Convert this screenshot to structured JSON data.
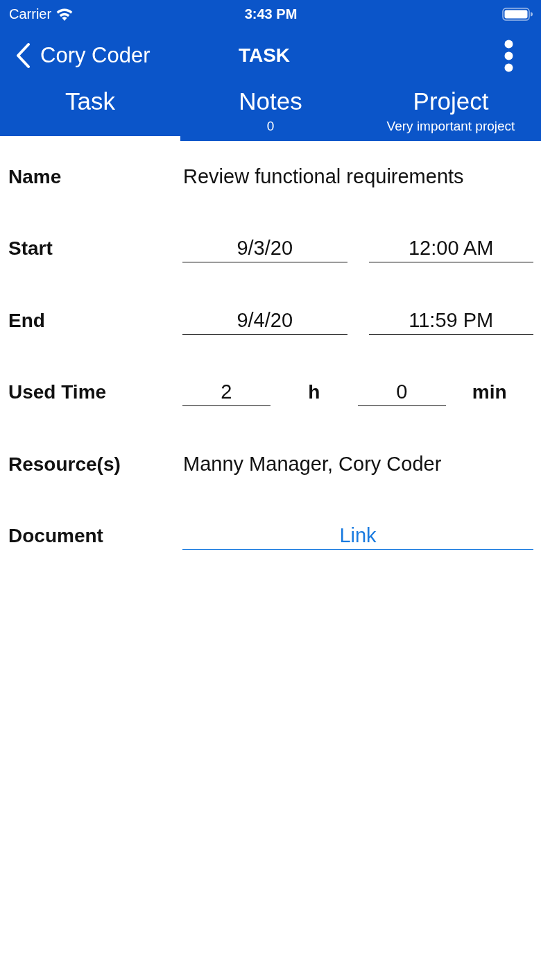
{
  "status_bar": {
    "carrier": "Carrier",
    "time": "3:43 PM"
  },
  "nav_bar": {
    "back_label": "Cory Coder",
    "title": "TASK"
  },
  "tabs": [
    {
      "label": "Task",
      "selected": true
    },
    {
      "label": "Notes",
      "subtitle": "0",
      "selected": false
    },
    {
      "label": "Project",
      "subtitle": "Very important project",
      "selected": false
    }
  ],
  "form": {
    "rows": [
      {
        "kind": "text",
        "label": "Name",
        "value": "Review functional requirements"
      },
      {
        "kind": "datetime",
        "label": "Start",
        "date": "9/3/20",
        "time": "12:00 AM"
      },
      {
        "kind": "datetime",
        "label": "End",
        "date": "9/4/20",
        "time": "11:59 PM"
      },
      {
        "kind": "duration",
        "label": "Used Time",
        "hours": "2",
        "hours_unit": "h",
        "minutes": "0",
        "minutes_unit": "min"
      },
      {
        "kind": "text",
        "label": "Resource(s)",
        "value": "Manny Manager, Cory Coder"
      },
      {
        "kind": "link",
        "label": "Document",
        "value": "Link"
      }
    ]
  }
}
